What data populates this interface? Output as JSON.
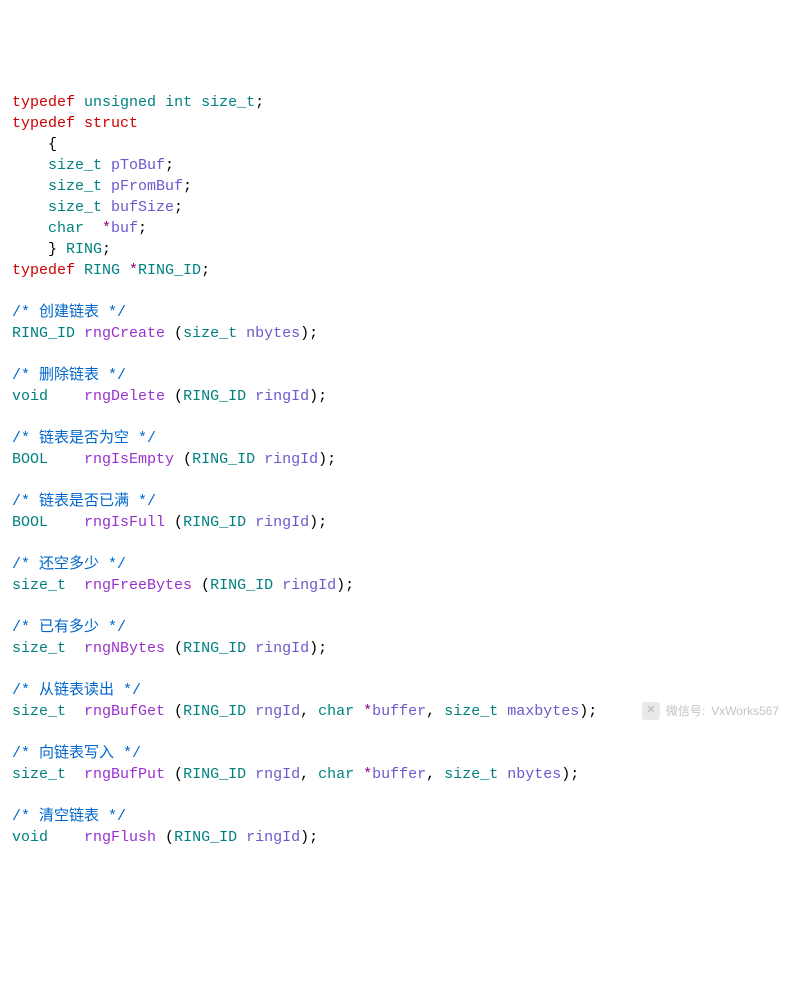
{
  "code": {
    "l01_kw1": "typedef",
    "l01_kw2": "unsigned",
    "l01_kw3": "int",
    "l01_type": "size_t",
    "l02_kw1": "typedef",
    "l02_kw2": "struct",
    "l03_open": "    {",
    "l04_type": "    size_t",
    "l04_id": " pToBuf",
    "l05_type": "    size_t",
    "l05_id": " pFromBuf",
    "l06_type": "    size_t",
    "l06_id": " bufSize",
    "l07_type": "    char  ",
    "l07_id": "buf",
    "l08_close": "    }",
    "l08_type": " RING",
    "l09_kw": "typedef",
    "l09_type1": " RING ",
    "l09_type2": "RING_ID",
    "cm1": "/* 创建链表 */",
    "f1_ret": "RING_ID",
    "f1_name": " rngCreate ",
    "f1_pt": "size_t",
    "f1_pn": " nbytes",
    "cm2": "/* 删除链表 */",
    "f2_ret": "void",
    "f2_name": "    rngDelete ",
    "f2_pt": "RING_ID",
    "f2_pn": " ringId",
    "cm3": "/* 链表是否为空 */",
    "f3_ret": "BOOL",
    "f3_name": "    rngIsEmpty ",
    "f3_pt": "RING_ID",
    "f3_pn": " ringId",
    "cm4": "/* 链表是否已满 */",
    "f4_ret": "BOOL",
    "f4_name": "    rngIsFull ",
    "f4_pt": "RING_ID",
    "f4_pn": " ringId",
    "cm5": "/* 还空多少 */",
    "f5_ret": "size_t",
    "f5_name": "  rngFreeBytes ",
    "f5_pt": "RING_ID",
    "f5_pn": " ringId",
    "cm6": "/* 已有多少 */",
    "f6_ret": "size_t",
    "f6_name": "  rngNBytes ",
    "f6_pt": "RING_ID",
    "f6_pn": " ringId",
    "cm7": "/* 从链表读出 */",
    "f7_ret": "size_t",
    "f7_name": "  rngBufGet ",
    "f7_pt1": "RING_ID",
    "f7_pn1": " rngId",
    "f7_pt2": "char",
    "f7_pn2": "buffer",
    "f7_pt3": "size_t",
    "f7_pn3": " maxbytes",
    "cm8": "/* 向链表写入 */",
    "f8_ret": "size_t",
    "f8_name": "  rngBufPut ",
    "f8_pt1": "RING_ID",
    "f8_pn1": " rngId",
    "f8_pt2": "char",
    "f8_pn2": "buffer",
    "f8_pt3": "size_t",
    "f8_pn3": " nbytes",
    "cm9": "/* 清空链表 */",
    "f9_ret": "void",
    "f9_name": "    rngFlush ",
    "f9_pt": "RING_ID",
    "f9_pn": " ringId"
  },
  "watermark": {
    "label": "微信号:",
    "value": "VxWorks567",
    "icon": "✕"
  }
}
